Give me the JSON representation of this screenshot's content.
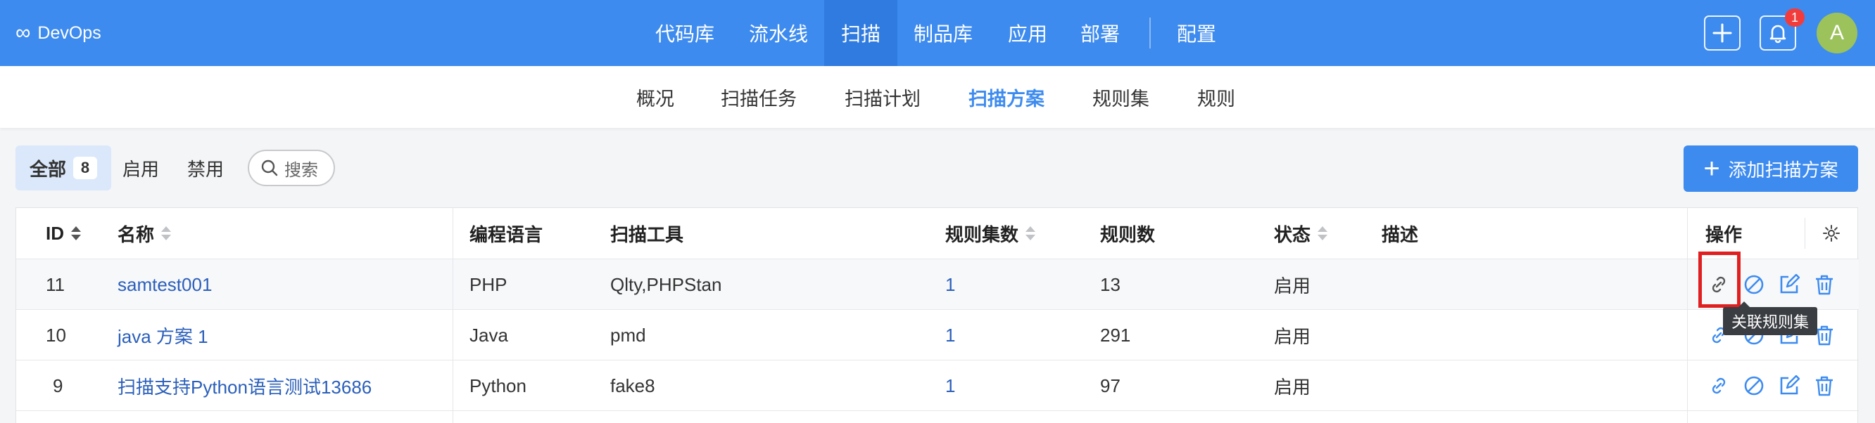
{
  "brand": {
    "name": "DevOps",
    "logo_glyph": "∞"
  },
  "top_nav": {
    "items": [
      "代码库",
      "流水线",
      "扫描",
      "制品库",
      "应用",
      "部署",
      "配置"
    ],
    "active": "扫描"
  },
  "header_actions": {
    "notification_count": "1",
    "avatar_initial": "A"
  },
  "sub_nav": {
    "items": [
      "概况",
      "扫描任务",
      "扫描计划",
      "扫描方案",
      "规则集",
      "规则"
    ],
    "active": "扫描方案"
  },
  "filters": {
    "all_label": "全部",
    "all_count": "8",
    "enabled_label": "启用",
    "disabled_label": "禁用",
    "search_placeholder": "搜索"
  },
  "add_button_label": "添加扫描方案",
  "table": {
    "columns": [
      "ID",
      "名称",
      "编程语言",
      "扫描工具",
      "规则集数",
      "规则数",
      "状态",
      "描述",
      "操作"
    ],
    "rows": [
      {
        "id": "11",
        "name": "samtest001",
        "language": "PHP",
        "tools": "Qlty,PHPStan",
        "ruleset_count": "1",
        "rule_count": "13",
        "status": "启用",
        "desc": ""
      },
      {
        "id": "10",
        "name": "java 方案 1",
        "language": "Java",
        "tools": "pmd",
        "ruleset_count": "1",
        "rule_count": "291",
        "status": "启用",
        "desc": ""
      },
      {
        "id": "9",
        "name": "扫描支持Python语言测试13686",
        "language": "Python",
        "tools": "fake8",
        "ruleset_count": "1",
        "rule_count": "97",
        "status": "启用",
        "desc": ""
      }
    ]
  },
  "tooltip": "关联规则集",
  "colors": {
    "primary": "#3d8bef",
    "link": "#2b5fba",
    "badge": "#f23c3c",
    "highlight": "#e02020"
  },
  "icons": [
    "link-icon",
    "ban-icon",
    "edit-icon",
    "trash-icon",
    "gear-icon",
    "plus-icon",
    "bell-icon",
    "search-icon"
  ]
}
